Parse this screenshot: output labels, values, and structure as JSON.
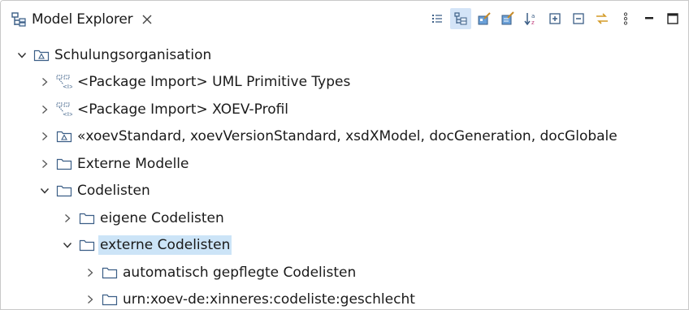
{
  "tab": {
    "title": "Model Explorer",
    "close_symbol": "×"
  },
  "toolbar": {
    "buttons": [
      {
        "icon": "list-view-icon",
        "active": false
      },
      {
        "icon": "tree-view-icon",
        "active": true
      },
      {
        "icon": "diagram-edit-icon",
        "active": false
      },
      {
        "icon": "edit-properties-icon",
        "active": false
      },
      {
        "icon": "sort-az-icon",
        "active": false
      },
      {
        "icon": "expand-all-icon",
        "active": false
      },
      {
        "icon": "collapse-all-icon",
        "active": false
      },
      {
        "icon": "link-with-editor-icon",
        "active": false
      },
      {
        "icon": "view-menu-icon",
        "active": false
      },
      {
        "icon": "minimize-icon",
        "active": false
      },
      {
        "icon": "maximize-icon",
        "active": false
      }
    ]
  },
  "tree": {
    "items": [
      {
        "label": "Schulungsorganisation",
        "level": 0,
        "expanded": true,
        "icon": "model-icon"
      },
      {
        "label": "<Package Import> UML Primitive Types",
        "level": 1,
        "expanded": false,
        "icon": "package-import-icon"
      },
      {
        "label": "<Package Import> XOEV-Profil",
        "level": 1,
        "expanded": false,
        "icon": "package-import-icon"
      },
      {
        "label": "«xoevStandard, xoevVersionStandard, xsdXModel, docGeneration, docGlobale",
        "level": 1,
        "expanded": false,
        "icon": "model-icon"
      },
      {
        "label": "Externe Modelle",
        "level": 1,
        "expanded": false,
        "icon": "package-icon"
      },
      {
        "label": "Codelisten",
        "level": 1,
        "expanded": true,
        "icon": "package-icon"
      },
      {
        "label": "eigene Codelisten",
        "level": 2,
        "expanded": false,
        "icon": "package-icon"
      },
      {
        "label": "externe Codelisten",
        "level": 2,
        "expanded": true,
        "icon": "package-icon",
        "selected": true
      },
      {
        "label": "automatisch gepflegte Codelisten",
        "level": 3,
        "expanded": false,
        "icon": "package-icon"
      },
      {
        "label": "urn:xoev-de:xinneres:codeliste:geschlecht",
        "level": 3,
        "expanded": false,
        "icon": "package-icon"
      }
    ]
  },
  "colors": {
    "selection": "#cce4f7",
    "toolbar_active": "#d4e4f7",
    "icon_stroke": "#3b5e86",
    "text": "#1a1a1a"
  }
}
